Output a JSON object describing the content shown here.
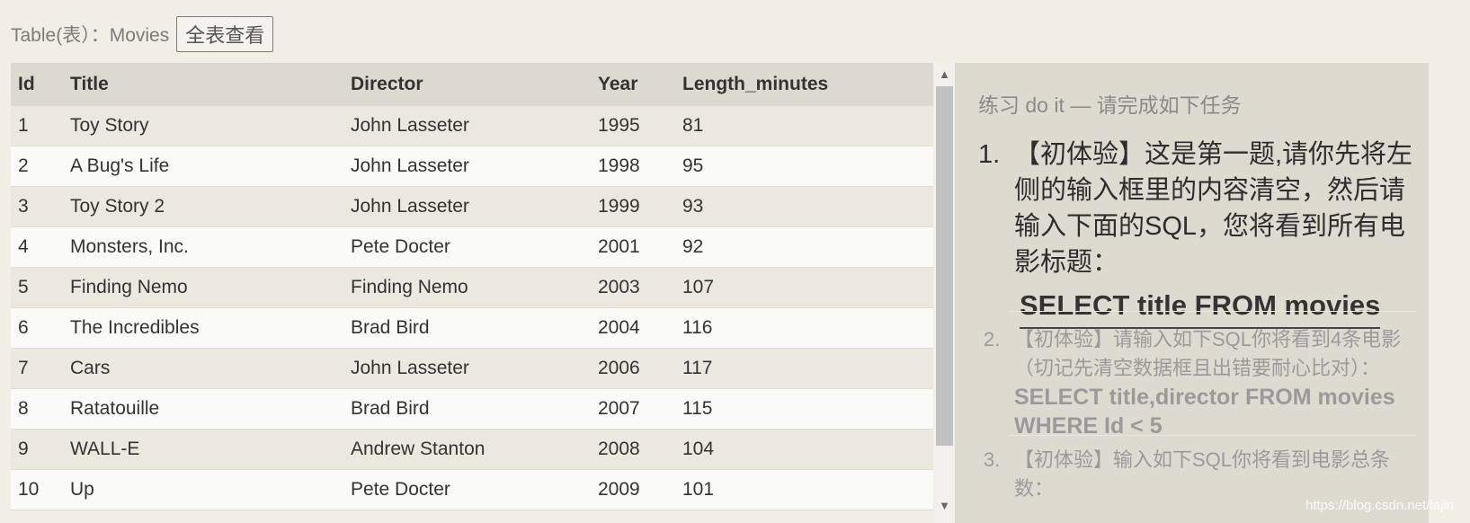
{
  "toolbar": {
    "table_label": "Table(表）：Movies",
    "view_all_label": "全表查看"
  },
  "table": {
    "headers": [
      "Id",
      "Title",
      "Director",
      "Year",
      "Length_minutes"
    ],
    "rows": [
      [
        "1",
        "Toy Story",
        "John Lasseter",
        "1995",
        "81"
      ],
      [
        "2",
        "A Bug's Life",
        "John Lasseter",
        "1998",
        "95"
      ],
      [
        "3",
        "Toy Story 2",
        "John Lasseter",
        "1999",
        "93"
      ],
      [
        "4",
        "Monsters, Inc.",
        "Pete Docter",
        "2001",
        "92"
      ],
      [
        "5",
        "Finding Nemo",
        "Finding Nemo",
        "2003",
        "107"
      ],
      [
        "6",
        "The Incredibles",
        "Brad Bird",
        "2004",
        "116"
      ],
      [
        "7",
        "Cars",
        "John Lasseter",
        "2006",
        "117"
      ],
      [
        "8",
        "Ratatouille",
        "Brad Bird",
        "2007",
        "115"
      ],
      [
        "9",
        "WALL-E",
        "Andrew Stanton",
        "2008",
        "104"
      ],
      [
        "10",
        "Up",
        "Pete Docter",
        "2009",
        "101"
      ]
    ]
  },
  "scrollbar": {
    "up_icon": "▲",
    "down_icon": "▼"
  },
  "panel": {
    "heading": "练习 do it — 请完成如下任务",
    "tasks": [
      {
        "num": "1.",
        "text": "【初体验】这是第一题,请你先将左侧的输入框里的内容清空，然后请输入下面的SQL，您将看到所有电影标题：",
        "sql": "SELECT title FROM movies"
      },
      {
        "num": "2.",
        "text": "【初体验】请输入如下SQL你将看到4条电影（切记先清空数据框且出错要耐心比对）：",
        "sql": "SELECT title,director FROM movies WHERE Id < 5"
      },
      {
        "num": "3.",
        "text": "【初体验】输入如下SQL你将看到电影总条数："
      }
    ]
  },
  "watermark": "https://blog.csdn.net/lajin"
}
